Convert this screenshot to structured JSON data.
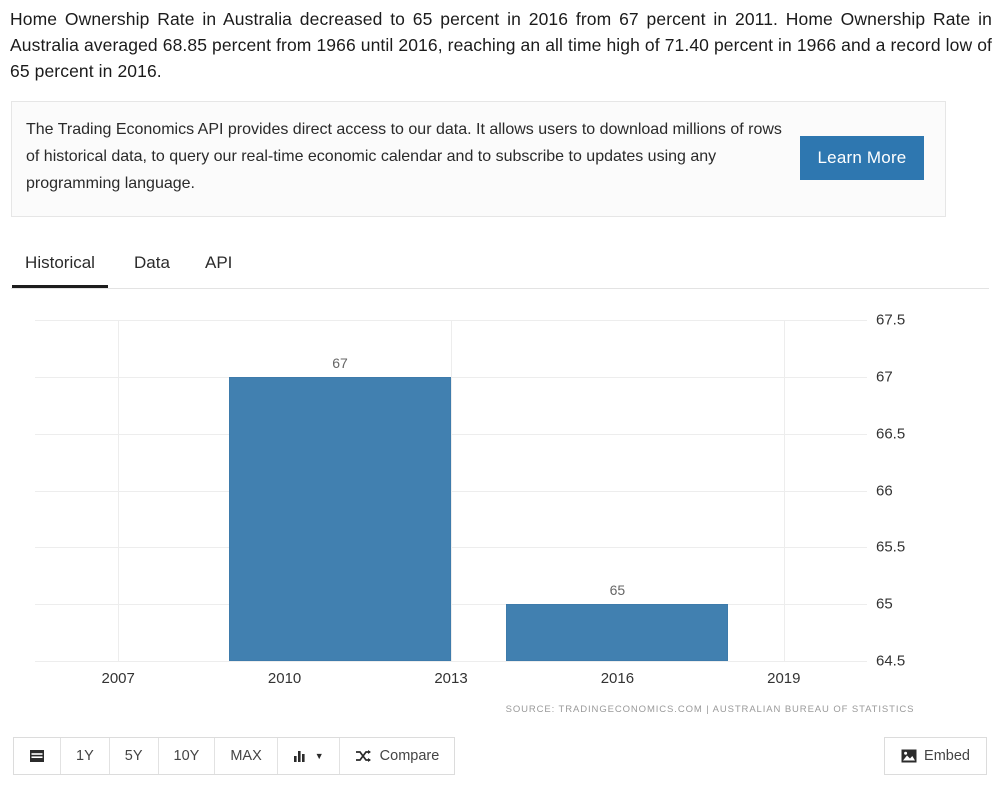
{
  "intro": {
    "paragraph": "Home Ownership Rate in Australia decreased to 65 percent in 2016 from 67 percent in 2011. Home Ownership Rate in Australia averaged 68.85 percent from 1966 until 2016, reaching an all time high of 71.40 percent in 1966 and a record low of 65 percent in 2016."
  },
  "api_card": {
    "text": "The Trading Economics API provides direct access to our data. It allows users to download millions of rows of historical data, to query our real-time economic calendar and to subscribe to updates using any programming language.",
    "button_label": "Learn More",
    "button_color": "#2e77b0"
  },
  "tabs": [
    {
      "label": "Historical",
      "active": true
    },
    {
      "label": "Data",
      "active": false
    },
    {
      "label": "API",
      "active": false
    }
  ],
  "toolbar": {
    "range_buttons": [
      "1Y",
      "5Y",
      "10Y",
      "MAX"
    ],
    "calendar_icon": "calendar-icon",
    "chart_type_icon": "bar-chart-icon",
    "chart_type_caret": "▼",
    "compare_label": "Compare",
    "compare_icon": "shuffle-icon",
    "embed_label": "Embed",
    "embed_icon": "image-icon"
  },
  "chart_data": {
    "type": "bar",
    "title": "",
    "xlabel": "",
    "ylabel": "",
    "categories": [
      "2011",
      "2016"
    ],
    "values": [
      67,
      65
    ],
    "data_labels": [
      "67",
      "65"
    ],
    "x_positions": [
      2011,
      2016
    ],
    "bar_color": "#4180b0",
    "ylim": [
      64.5,
      67.5
    ],
    "yticks": [
      "67.5",
      "67",
      "66.5",
      "66",
      "65.5",
      "65",
      "64.5"
    ],
    "ytick_values": [
      67.5,
      67,
      66.5,
      66,
      65.5,
      65,
      64.5
    ],
    "xticks": [
      "2007",
      "2010",
      "2013",
      "2016",
      "2019"
    ],
    "xtick_values": [
      2007,
      2010,
      2013,
      2016,
      2019
    ],
    "xlim": [
      2005.5,
      2020.5
    ],
    "grid": true,
    "legend": false,
    "source": "SOURCE: TRADINGECONOMICS.COM | AUSTRALIAN BUREAU OF STATISTICS"
  }
}
